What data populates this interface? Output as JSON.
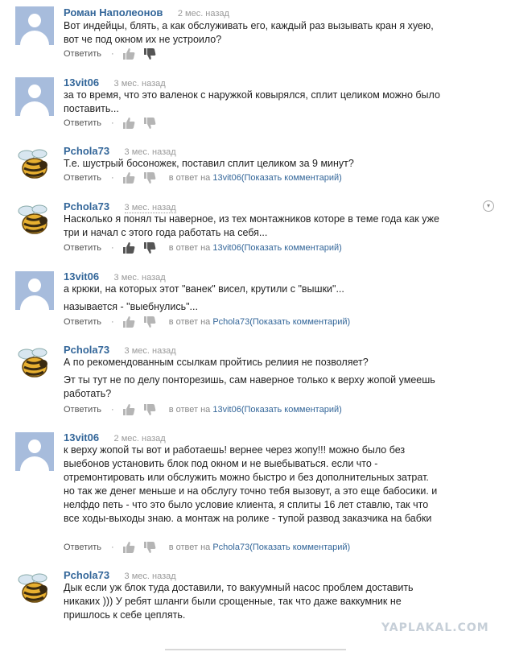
{
  "labels": {
    "reply": "Ответить",
    "in_reply_to": "в ответ на",
    "show_comment": "(Показать комментарий)",
    "dot": "·"
  },
  "comments": [
    {
      "author": "Роман Наполеонов",
      "time": "2 мес. назад",
      "avatar": "default-user-avatar",
      "paragraphs": [
        "Вот индейцы, блять, а как обслуживать его, каждый раз вызывать кран я хуею, вот че под окном их не устроило?"
      ],
      "reply_to": ""
    },
    {
      "author": "13vit06",
      "time": "3 мес. назад",
      "avatar": "default-user-avatar",
      "paragraphs": [
        "за то время, что это валенок с наружкой ковырялся, сплит целиком можно было поставить..."
      ],
      "reply_to": ""
    },
    {
      "author": "Pchola73",
      "time": "3 мес. назад",
      "avatar": "bee-avatar",
      "paragraphs": [
        "Т.е. шустрый босоножек, поставил сплит целиком за 9 минут?"
      ],
      "reply_to": "13vit06"
    },
    {
      "author": "Pchola73",
      "time": "3 мес. назад",
      "avatar": "bee-avatar",
      "paragraphs": [
        "Насколько я понял ты наверное, из тех монтажников которе в теме года как уже три и начал с этого года работать на себя..."
      ],
      "reply_to": "13vit06"
    },
    {
      "author": "13vit06",
      "time": "3 мес. назад",
      "avatar": "default-user-avatar",
      "paragraphs": [
        "а крюки, на которых этот \"ванек\" висел, крутили с \"вышки\"...",
        "называется - \"выебнулись\"..."
      ],
      "reply_to": "Pchola73"
    },
    {
      "author": "Pchola73",
      "time": "3 мес. назад",
      "avatar": "bee-avatar",
      "paragraphs": [
        "А по рекомендованным ссылкам пройтись релиия не позволяет?",
        "Эт ты тут не по делу понторезишь, сам наверное только к верху жопой умеешь работать?"
      ],
      "reply_to": "13vit06"
    },
    {
      "author": "13vit06",
      "time": "2 мес. назад",
      "avatar": "default-user-avatar",
      "paragraphs": [
        "к верху жопой ты вот и работаешь! вернее через жопу!!! можно было без выебонов установить блок под окном и не выебываться. если что - отремонтировать или обслужить можно быстро и без дополнительных затрат. но так же денег меньше и на обслугу точно тебя вызовут, а это еще бабосики. и нелфдо петь - что это было условие клиента, я сплиты 16 лет ставлю, так что все ходы-выходы знаю. а монтаж на ролике - тупой развод заказчика на бабки"
      ],
      "reply_to": "Pchola73"
    },
    {
      "author": "Pchola73",
      "time": "3 мес. назад",
      "avatar": "bee-avatar",
      "paragraphs": [
        "Дык если уж блок туда доставили, то вакуумный насос проблем доставить никаких ))) У ребят шланги были срощенные, так что даже ваккумник не пришлось к себе цеплять."
      ],
      "reply_to": ""
    }
  ],
  "watermark": "YAPLAKAL.COM",
  "collapse_icon": "chevron-down-circle-icon"
}
